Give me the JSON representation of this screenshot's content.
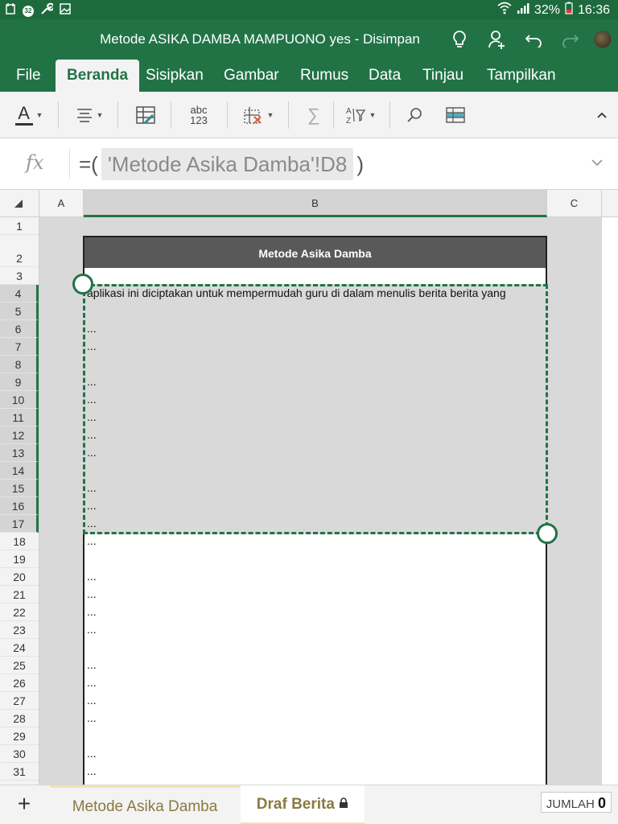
{
  "status_bar": {
    "notif_count": "32",
    "battery": "32%",
    "time": "16:36"
  },
  "window": {
    "title": "Metode ASIKA DAMBA MAMPUONO yes - Disimpan"
  },
  "ribbon": {
    "tabs": [
      "File",
      "Beranda",
      "Sisipkan",
      "Gambar",
      "Rumus",
      "Data",
      "Tinjau",
      "Tampilkan"
    ],
    "active_tab": "Beranda"
  },
  "toolbar": {
    "font_color_icon": "A",
    "spelling_label_top": "abc",
    "spelling_label_bottom": "123",
    "sum_icon": "∑"
  },
  "formula_bar": {
    "fx": "fx",
    "prefix": "=(",
    "reference": "'Metode   Asika   Damba'!D8",
    "suffix": ")"
  },
  "grid": {
    "columns": [
      "A",
      "B",
      "C"
    ],
    "selected_column": "B",
    "rows": [
      "1",
      "2",
      "3",
      "4",
      "5",
      "6",
      "7",
      "8",
      "9",
      "10",
      "11",
      "12",
      "13",
      "14",
      "15",
      "16",
      "17",
      "18",
      "19",
      "20",
      "21",
      "22",
      "23",
      "24",
      "25",
      "26",
      "27",
      "28",
      "29",
      "30",
      "31"
    ],
    "selected_rows": [
      "4",
      "5",
      "6",
      "7",
      "8",
      "9",
      "10",
      "11",
      "12",
      "13",
      "14",
      "15",
      "16",
      "17"
    ]
  },
  "sheet_content": {
    "header": "Metode Asika Damba",
    "row4_text": "aplikasi ini diciptakan untuk mempermudah guru di dalam menulis berita berita yang",
    "ellipsis": "...",
    "ellipsis_rows": [
      "6",
      "7",
      "9",
      "10",
      "11",
      "12",
      "13",
      "15",
      "16",
      "17",
      "18",
      "20",
      "21",
      "22",
      "23",
      "25",
      "26",
      "27",
      "28",
      "30",
      "31"
    ]
  },
  "sheets": {
    "tabs": [
      "Metode Asika Damba",
      "Draf Berita"
    ],
    "active": "Draf Berita"
  },
  "status": {
    "sum_label": "JUMLAH",
    "sum_value": "0"
  }
}
